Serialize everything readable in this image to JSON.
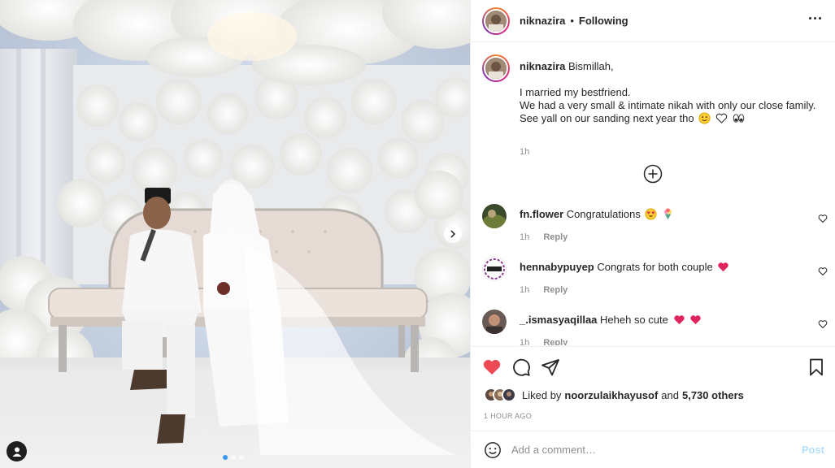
{
  "header": {
    "username": "niknazira",
    "separator": "•",
    "follow_status": "Following"
  },
  "caption": {
    "username": "niknazira",
    "lines": [
      "Bismillah,",
      "",
      "I married my bestfriend.",
      "We had a very small & intimate nikah with only our close family.",
      "See yall on our sanding next year tho"
    ],
    "emojis": [
      "slightly-smiling-face-emoji",
      "white-heart-emoji",
      "eyes-emoji"
    ],
    "time": "1h"
  },
  "comments": [
    {
      "username": "fn.flower",
      "text": "Congratulations",
      "emojis": [
        "heart-eyes-emoji",
        "bouquet-emoji"
      ],
      "time": "1h",
      "reply_label": "Reply"
    },
    {
      "username": "hennabypuyep",
      "text": "Congrats for both couple",
      "emojis": [
        "red-heart-emoji"
      ],
      "time": "1h",
      "reply_label": "Reply"
    },
    {
      "username": "_.ismasyaqillaa",
      "text": "Heheh so cute",
      "emojis": [
        "red-heart-emoji",
        "red-heart-emoji"
      ],
      "time": "1h",
      "reply_label": "Reply"
    }
  ],
  "likes": {
    "prefix": "Liked by",
    "user": "noorzulaikhayusof",
    "and": "and",
    "others": "5,730 others"
  },
  "timestamp": "1 HOUR AGO",
  "add_comment": {
    "placeholder": "Add a comment…",
    "post_label": "Post"
  },
  "carousel": {
    "slide_count": 3,
    "active_index": 0
  },
  "colors": {
    "like_red": "#ed4956",
    "post_button_disabled": "#b2dffc",
    "carousel_active_dot": "#3897f0",
    "text_muted": "#8e8e8e"
  }
}
